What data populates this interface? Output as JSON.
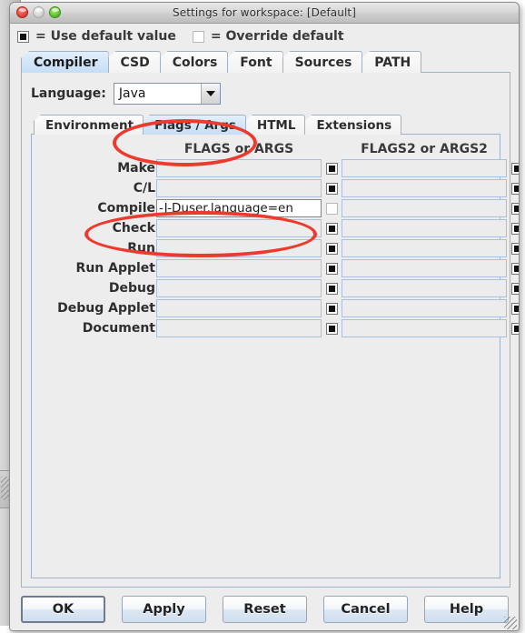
{
  "window": {
    "title": "Settings for workspace: [Default]",
    "traffic_lights": [
      "close",
      "minimize",
      "zoom"
    ]
  },
  "legend": {
    "default_label": "= Use default value",
    "override_label": "= Override default"
  },
  "main_tabs": [
    {
      "label": "Compiler",
      "selected": true
    },
    {
      "label": "CSD",
      "selected": false
    },
    {
      "label": "Colors",
      "selected": false
    },
    {
      "label": "Font",
      "selected": false
    },
    {
      "label": "Sources",
      "selected": false
    },
    {
      "label": "PATH",
      "selected": false
    }
  ],
  "language": {
    "label": "Language:",
    "value": "Java",
    "arrow_icon": "chevron-down-icon"
  },
  "sub_tabs": [
    {
      "label": "Environment",
      "selected": false
    },
    {
      "label": "Flags / Args",
      "selected": true
    },
    {
      "label": "HTML",
      "selected": false
    },
    {
      "label": "Extensions",
      "selected": false
    }
  ],
  "grid": {
    "col1_header": "FLAGS or ARGS",
    "col2_header": "FLAGS2 or ARGS2",
    "rows": [
      {
        "label": "Make",
        "flags": "",
        "flags_default": true,
        "flags2": "",
        "flags2_default": true
      },
      {
        "label": "C/L",
        "flags": "",
        "flags_default": true,
        "flags2": "",
        "flags2_default": true
      },
      {
        "label": "Compile",
        "flags": "-J-Duser.language=en",
        "flags_default": false,
        "flags2": "",
        "flags2_default": true
      },
      {
        "label": "Check",
        "flags": "",
        "flags_default": true,
        "flags2": "",
        "flags2_default": true
      },
      {
        "label": "Run",
        "flags": "",
        "flags_default": true,
        "flags2": "",
        "flags2_default": true
      },
      {
        "label": "Run Applet",
        "flags": "",
        "flags_default": true,
        "flags2": "",
        "flags2_default": true
      },
      {
        "label": "Debug",
        "flags": "",
        "flags_default": true,
        "flags2": "",
        "flags2_default": true
      },
      {
        "label": "Debug Applet",
        "flags": "",
        "flags_default": true,
        "flags2": "",
        "flags2_default": true
      },
      {
        "label": "Document",
        "flags": "",
        "flags_default": true,
        "flags2": "",
        "flags2_default": true
      }
    ]
  },
  "buttons": [
    {
      "label": "OK",
      "default": true
    },
    {
      "label": "Apply",
      "default": false
    },
    {
      "label": "Reset",
      "default": false
    },
    {
      "label": "Cancel",
      "default": false
    },
    {
      "label": "Help",
      "default": false
    }
  ],
  "annotations": {
    "color": "#ec3b2e",
    "shapes": [
      {
        "name": "flags-args-tab-highlight",
        "target": "Flags / Args"
      },
      {
        "name": "compile-flags-highlight",
        "target": "-J-Duser.language=en"
      }
    ]
  }
}
